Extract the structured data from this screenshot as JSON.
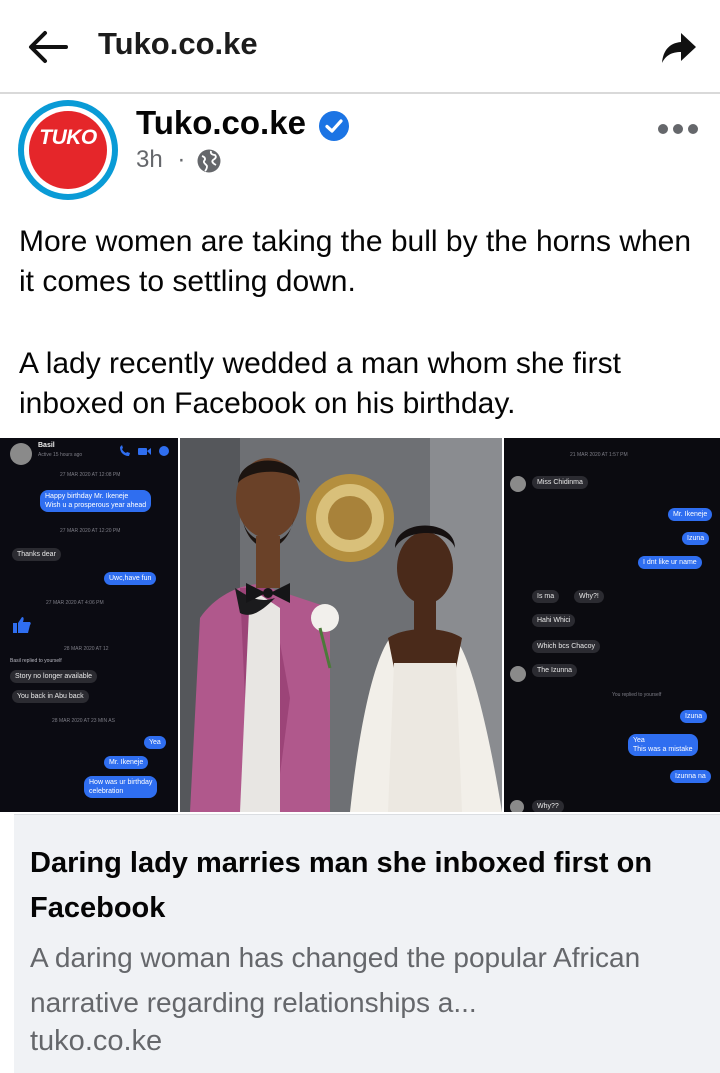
{
  "topbar": {
    "title": "Tuko.co.ke",
    "back_icon": "arrow-left-icon",
    "share_icon": "share-arrow-icon"
  },
  "post": {
    "page_name": "Tuko.co.ke",
    "logo_text": "TUKO",
    "time": "3h",
    "separator": "·",
    "audience_icon": "globe-icon",
    "verified_icon": "verified-badge-icon",
    "more_icon": "more-dots-icon",
    "text_p1": "More women are taking the bull by the horns when it comes to settling down.",
    "text_p2": "A lady recently wedded a man whom she first inboxed on Facebook on his birthday."
  },
  "image": {
    "left_chat": {
      "contact": "Basil",
      "contact_status": "Active 15 hours ago",
      "stamp_1": "27 MAR 2020 AT 12:08 PM",
      "msg_1": "Happy birthday Mr. Ikeneje",
      "msg_1b": "Wish u a prosperous year ahead",
      "stamp_2": "27 MAR 2020 AT 12:20 PM",
      "msg_2": "Thanks dear",
      "msg_3": "Uwc,have fun",
      "stamp_3": "27 MAR 2020 AT 4:06 PM",
      "stamp_4": "28 MAR 2020 AT 12",
      "msg_4": "Basil replied to yourself",
      "msg_5": "Story no longer available",
      "msg_6": "You back in Abu back",
      "stamp_5": "28 MAR 2020 AT 23 MIN AS",
      "msg_7": "Yea",
      "msg_8": "Mr. Ikeneje",
      "msg_9": "How was ur birthday",
      "msg_9b": "celebration"
    },
    "right_chat": {
      "stamp_1": "21 MAR 2020 AT 1:57 PM",
      "msg_1": "Miss Chidinma",
      "msg_2": "Mr. Ikeneje",
      "msg_3": "Izuna",
      "msg_4": "I dnt like ur name",
      "msg_5": "Is ma",
      "msg_6": "Why?!",
      "msg_7": "Hahi Whici",
      "msg_8": "Which bcs Chacoy",
      "msg_9": "The Izunna",
      "stamp_2": "You replied to yourself",
      "msg_10": "Izuna",
      "msg_11": "Yea",
      "msg_11b": "This was a mistake",
      "msg_12": "Izunna na",
      "msg_13": "Why??"
    }
  },
  "link_card": {
    "title": "Daring lady marries man she inboxed first on Facebook",
    "description": "A daring woman has changed the popular African narrative regarding relationships a...",
    "domain": "tuko.co.ke"
  },
  "colors": {
    "verified_blue": "#1b74e4",
    "logo_red": "#e5262a",
    "logo_ring": "#0a9bd6",
    "messenger_blue": "#2f6ef0"
  }
}
